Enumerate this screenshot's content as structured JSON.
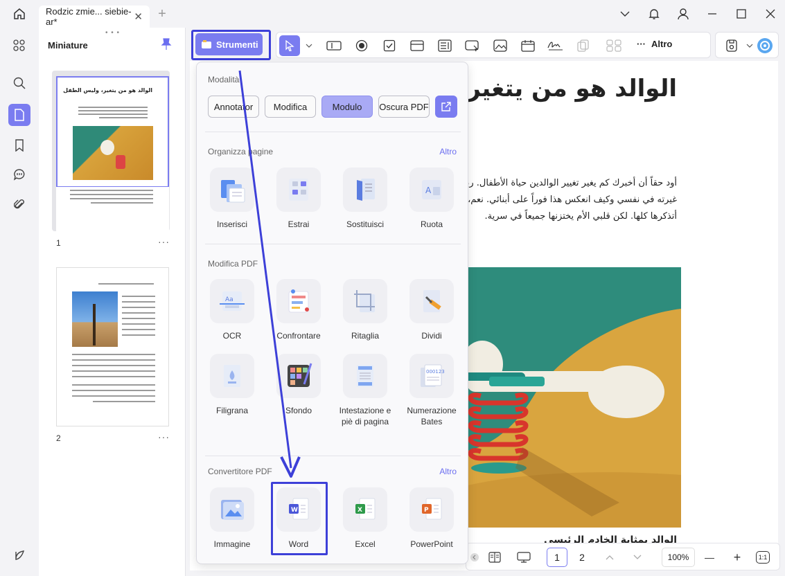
{
  "tab": {
    "title": "Rodzic zmie... siebie-ar*",
    "close": "✕",
    "new": "+"
  },
  "thumbnails": {
    "title": "Miniature",
    "pages": [
      {
        "number": "1",
        "title": "الوالد هو من يتغير، وليس الطفل",
        "more": "···"
      },
      {
        "number": "2",
        "more": "···"
      }
    ]
  },
  "toolbar": {
    "strumenti": "Strumenti",
    "altro": "Altro",
    "more_dots": "···"
  },
  "document": {
    "title": "الوالد هو من يتغير،",
    "paragraph": [
      "أود حقاً أن أخبرك كم يغير تغيير الوالدين حياة الأطفال. ربما",
      "غيرته في نفسي وكيف انعكس هذا فوراً على أبنائي. نعم، لقد",
      "أتذكرها كلها. لكن قلبي الأم يختزنها جميعاً في سرية."
    ],
    "caption": "الوالد بمثابة الخادم الرئيسي"
  },
  "bottombar": {
    "pages": [
      "1",
      "2"
    ],
    "zoom": "100%",
    "minus": "—",
    "plus": "+",
    "fit": "1:1"
  },
  "panel": {
    "modalita": {
      "title": "Modalità",
      "buttons": [
        "Annotator",
        "Modifica",
        "Modulo",
        "Oscura PDF"
      ],
      "active": "Modulo"
    },
    "organizza": {
      "title": "Organizza pagine",
      "more": "Altro",
      "items": [
        "Inserisci",
        "Estrai",
        "Sostituisci",
        "Ruota"
      ]
    },
    "modifica": {
      "title": "Modifica PDF",
      "items": [
        "OCR",
        "Confrontare",
        "Ritaglia",
        "Dividi",
        "Filigrana",
        "Sfondo",
        "Intestazione e piè di pagina",
        "Numerazione Bates"
      ]
    },
    "convertitore": {
      "title": "Convertitore PDF",
      "more": "Altro",
      "items": [
        "Immagine",
        "Word",
        "Excel",
        "PowerPoint"
      ]
    }
  },
  "colors": {
    "accent": "#7a7cf0",
    "highlight": "#3d40d8",
    "link": "#6b6ef0"
  }
}
